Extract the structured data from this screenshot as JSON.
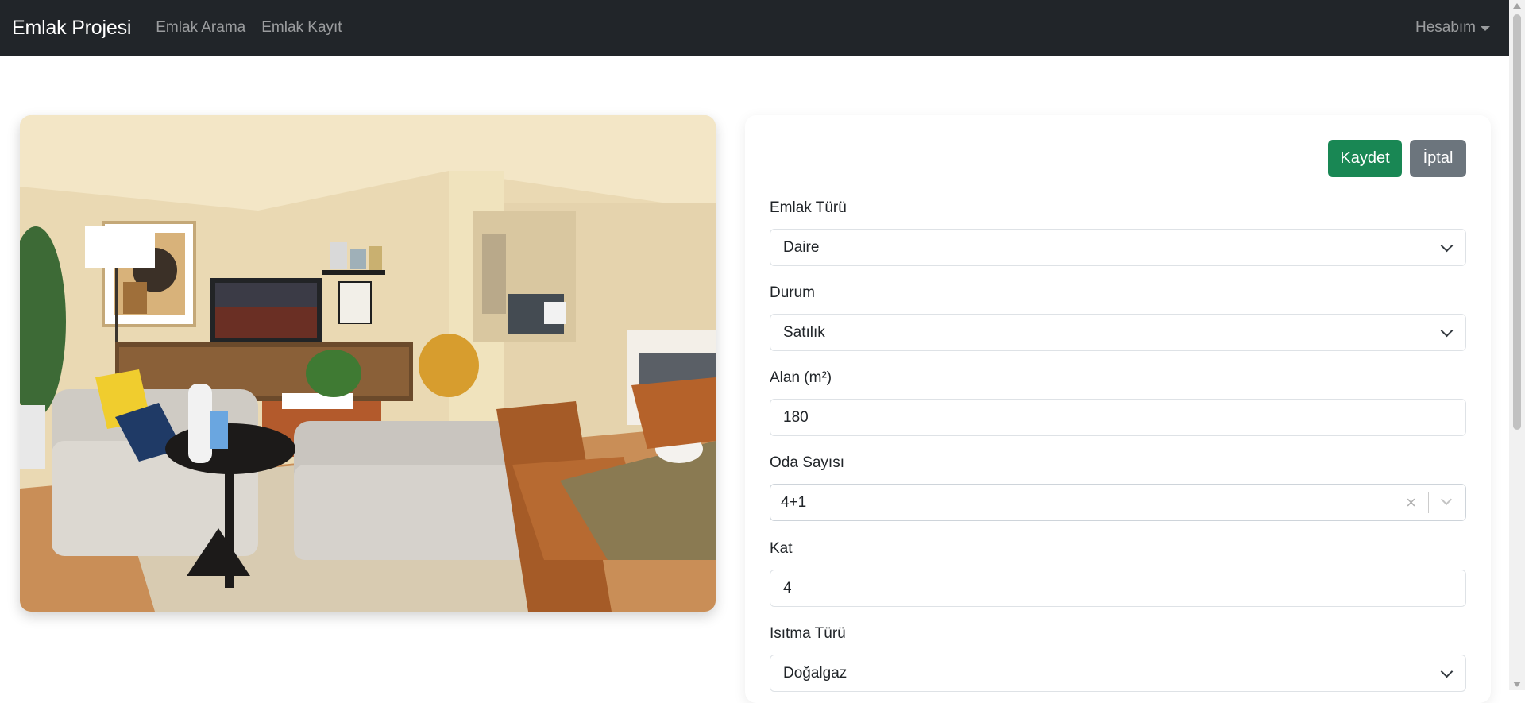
{
  "navbar": {
    "brand": "Emlak Projesi",
    "links": [
      "Emlak Arama",
      "Emlak Kayıt"
    ],
    "account": "Hesabım"
  },
  "colors": {
    "navbar_bg": "#212529",
    "save_button": "#198754",
    "cancel_button": "#6c757d"
  },
  "photo": {
    "alt": "Oturma odası fotoğrafı"
  },
  "form": {
    "save_label": "Kaydet",
    "cancel_label": "İptal",
    "fields": [
      {
        "label": "Emlak Türü",
        "value": "Daire",
        "type": "select"
      },
      {
        "label": "Durum",
        "value": "Satılık",
        "type": "select"
      },
      {
        "label": "Alan (m²)",
        "value": "180",
        "type": "input"
      },
      {
        "label": "Oda Sayısı",
        "value": "4+1",
        "type": "searchable-select"
      },
      {
        "label": "Kat",
        "value": "4",
        "type": "input"
      },
      {
        "label": "Isıtma Türü",
        "value": "Doğalgaz",
        "type": "select"
      }
    ]
  }
}
